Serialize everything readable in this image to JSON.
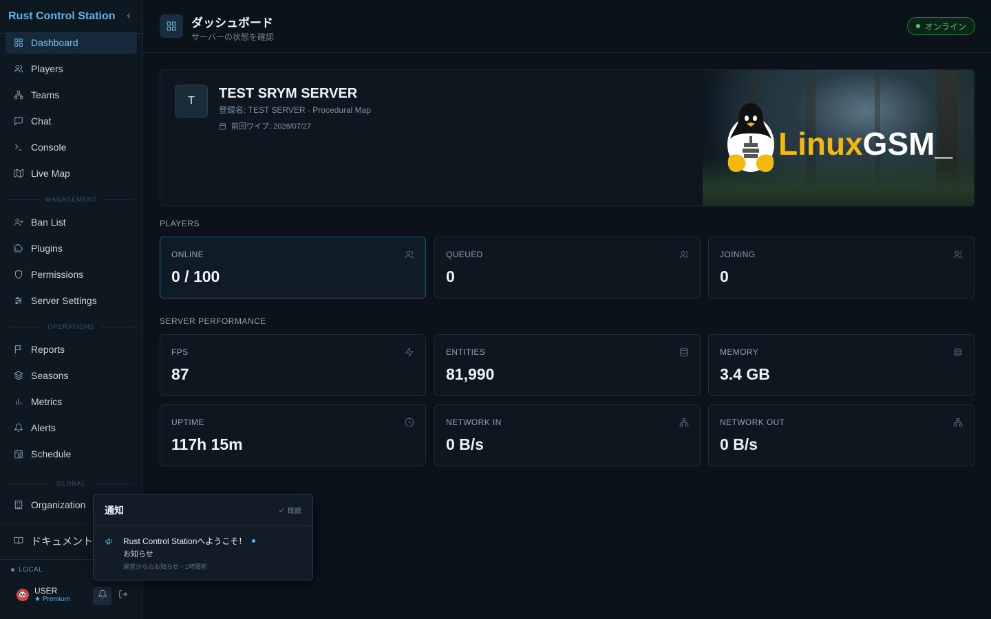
{
  "app": {
    "title": "Rust Control Station",
    "collapse_icon": "chevron-left-icon"
  },
  "sidebar": {
    "main_items": [
      {
        "label": "Dashboard",
        "icon": "grid-icon",
        "active": true
      },
      {
        "label": "Players",
        "icon": "users-icon"
      },
      {
        "label": "Teams",
        "icon": "network-icon"
      },
      {
        "label": "Chat",
        "icon": "message-icon"
      },
      {
        "label": "Console",
        "icon": "terminal-icon"
      },
      {
        "label": "Live Map",
        "icon": "map-icon"
      }
    ],
    "management_label": "MANAGEMENT",
    "management_items": [
      {
        "label": "Ban List",
        "icon": "user-x-icon"
      },
      {
        "label": "Plugins",
        "icon": "puzzle-icon"
      },
      {
        "label": "Permissions",
        "icon": "shield-icon"
      },
      {
        "label": "Server Settings",
        "icon": "sliders-icon"
      }
    ],
    "operations_label": "OPERATIONS",
    "operations_items": [
      {
        "label": "Reports",
        "icon": "flag-icon"
      },
      {
        "label": "Seasons",
        "icon": "layers-icon"
      },
      {
        "label": "Metrics",
        "icon": "bar-chart-icon"
      },
      {
        "label": "Alerts",
        "icon": "bell-icon"
      },
      {
        "label": "Schedule",
        "icon": "calendar-clock-icon"
      }
    ],
    "global_label": "GLOBAL",
    "global_items": [
      {
        "label": "Organization",
        "icon": "building-icon"
      }
    ],
    "docs_label": "ドキュメント",
    "env_label": "LOCAL",
    "user": {
      "avatar_text": "🐼",
      "name": "USER",
      "plan": "★ Premium"
    }
  },
  "header": {
    "title": "ダッシュボード",
    "subtitle": "サーバーの状態を確認",
    "status": "オンライン",
    "status_color": "#3ed17a"
  },
  "server": {
    "initial": "T",
    "name": "TEST SRYM SERVER",
    "registration": "登録名: TEST SERVER · Procedural Map",
    "last_wipe": "前回ワイプ: 2026/07/27",
    "banner_logo_text_1": "Linux",
    "banner_logo_text_2": "GSM_"
  },
  "players_section": {
    "title": "PLAYERS",
    "cards": [
      {
        "label": "ONLINE",
        "value": "0 / 100",
        "icon": "users-icon"
      },
      {
        "label": "QUEUED",
        "value": "0",
        "icon": "users-icon"
      },
      {
        "label": "JOINING",
        "value": "0",
        "icon": "users-icon"
      }
    ]
  },
  "performance_section": {
    "title": "SERVER PERFORMANCE",
    "cards": [
      {
        "label": "FPS",
        "value": "87",
        "icon": "zap-icon"
      },
      {
        "label": "ENTITIES",
        "value": "81,990",
        "icon": "database-icon"
      },
      {
        "label": "MEMORY",
        "value": "3.4 GB",
        "icon": "cpu-icon"
      },
      {
        "label": "UPTIME",
        "value": "117h 15m",
        "icon": "clock-icon"
      },
      {
        "label": "NETWORK IN",
        "value": "0 B/s",
        "icon": "network-icon"
      },
      {
        "label": "NETWORK OUT",
        "value": "0 B/s",
        "icon": "network-icon"
      }
    ]
  },
  "notifications": {
    "title": "通知",
    "mark_read": "既読",
    "items": [
      {
        "message": "Rust Control Stationへようこそ！",
        "category": "お知らせ",
        "meta": "運営からのお知らせ・1時間前",
        "unread": true,
        "icon": "megaphone-icon"
      }
    ]
  },
  "colors": {
    "accent": "#5cb6e6",
    "background": "#0b1219",
    "card": "#0e1720",
    "online": "#3ed17a",
    "logo_yellow": "#f2b90f"
  }
}
